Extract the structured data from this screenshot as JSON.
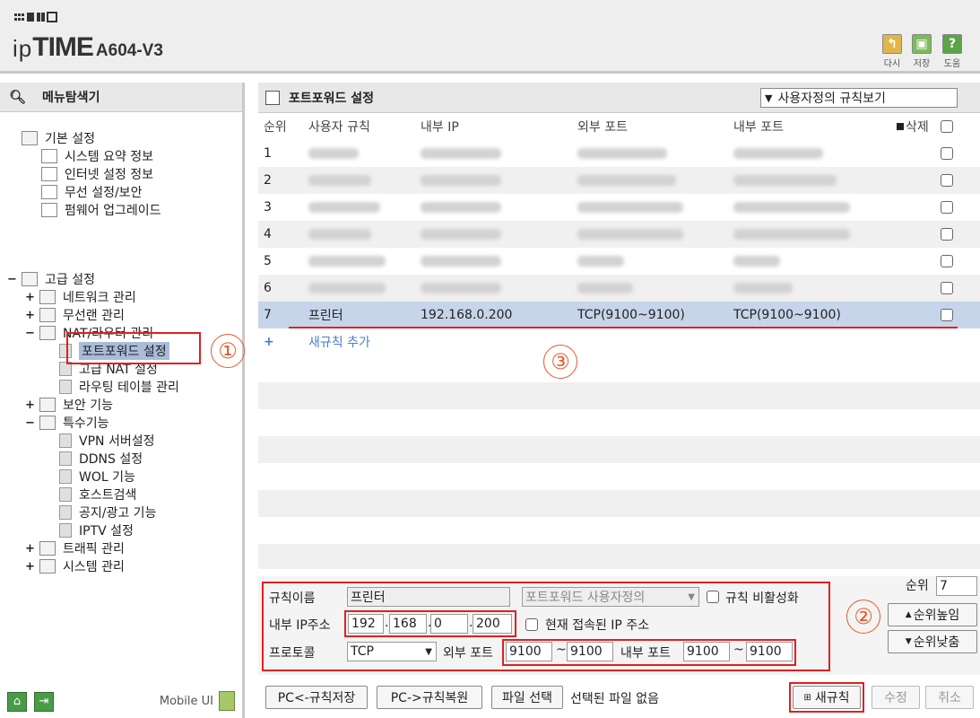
{
  "header": {
    "brand_ip": "ip",
    "brand_time": "TIME",
    "model": "A604-V3",
    "buttons": [
      {
        "label": "다시",
        "icon": "undo-icon",
        "color": "#e0b54a"
      },
      {
        "label": "저장",
        "icon": "save-icon",
        "color": "#7dbb5a"
      },
      {
        "label": "도움",
        "icon": "help-icon",
        "color": "#5da34a",
        "glyph": "?"
      }
    ]
  },
  "sidebar": {
    "title": "메뉴탐색기",
    "basic": {
      "label": "기본 설정",
      "items": [
        "시스템 요약 정보",
        "인터넷 설정 정보",
        "무선 설정/보안",
        "펌웨어 업그레이드"
      ]
    },
    "advanced": {
      "label": "고급 설정",
      "toggle": "−",
      "network": "네트워크 관리",
      "wireless": "무선랜 관리",
      "nat": "NAT/라우터 관리",
      "nat_items": [
        "포트포워드 설정",
        "고급 NAT 설정",
        "라우팅 테이블 관리"
      ],
      "security": "보안 기능",
      "special": "특수기능",
      "special_items": [
        "VPN 서버설정",
        "DDNS 설정",
        "WOL 기능",
        "호스트검색",
        "공지/광고 기능",
        "IPTV 설정"
      ],
      "traffic": "트래픽 관리",
      "system": "시스템 관리"
    },
    "toggle_plus": "+",
    "toggle_minus": "−",
    "mobile_label": "Mobile UI"
  },
  "main": {
    "title": "포트포워드 설정",
    "view_select": "사용자정의 규칙보기",
    "columns": {
      "rank": "순위",
      "rule": "사용자 규칙",
      "ip": "내부 IP",
      "ext": "외부 포트",
      "int": "내부 포트",
      "del": "삭제"
    },
    "rows": [
      {
        "rank": "1"
      },
      {
        "rank": "2"
      },
      {
        "rank": "3"
      },
      {
        "rank": "4"
      },
      {
        "rank": "5"
      },
      {
        "rank": "6"
      },
      {
        "rank": "7",
        "rule": "프린터",
        "ip": "192.168.0.200",
        "ext": "TCP(9100~9100)",
        "int": "TCP(9100~9100)"
      }
    ],
    "add_rule": "새규칙 추가",
    "add_plus": "+"
  },
  "form": {
    "rule_name_label": "규칙이름",
    "rule_name_value": "프린터",
    "preset_select": "포트포워드 사용자정의",
    "disable_label": "규칙 비활성화",
    "ip_label": "내부 IP주소",
    "ip_parts": [
      "192",
      "168",
      "0",
      "200"
    ],
    "ip_sep": ".",
    "current_ip_label": "현재 접속된 IP 주소",
    "protocol_label": "프로토콜",
    "protocol_value": "TCP",
    "ext_port_label": "외부 포트",
    "ext_from": "9100",
    "ext_to": "9100",
    "int_port_label": "내부 포트",
    "int_from": "9100",
    "int_to": "9100",
    "tilde": "~",
    "rank_label": "순위",
    "rank_value": "7",
    "up_btn": "순위높임",
    "down_btn": "순위낮춤"
  },
  "footer": {
    "save_btn": "PC<-규칙저장",
    "restore_btn": "PC->규칙복원",
    "file_btn": "파일 선택",
    "file_status": "선택된 파일 없음",
    "new_btn": "새규칙",
    "edit_btn": "수정",
    "cancel_btn": "취소"
  },
  "annotations": [
    "①",
    "②",
    "③"
  ],
  "colors": {
    "accent_red": "#e02020",
    "annotation": "#e55a2b",
    "highlight_row": "#c7d5ea",
    "tree_select": "#a9bcd9"
  }
}
